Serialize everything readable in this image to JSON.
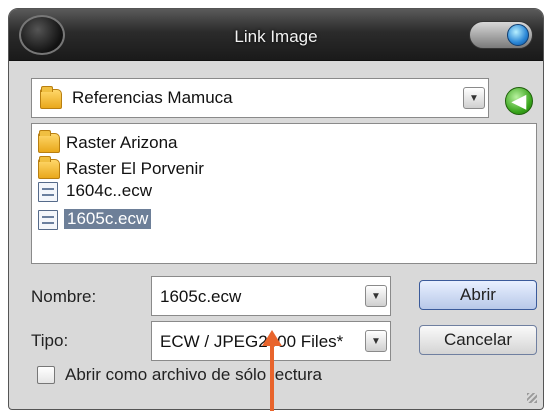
{
  "window": {
    "title": "Link Image"
  },
  "location": {
    "value": "Referencias Mamuca",
    "icon": "folder-icon"
  },
  "navigation": {
    "back_icon": "back-arrow-icon",
    "back_glyph": "◀"
  },
  "files": [
    {
      "name": "Raster Arizona",
      "type": "folder",
      "selected": false
    },
    {
      "name": "Raster El Porvenir",
      "type": "folder",
      "selected": false
    },
    {
      "name": "1604c..ecw",
      "type": "file",
      "selected": false
    },
    {
      "name": "1605c.ecw",
      "type": "file",
      "selected": true
    }
  ],
  "form": {
    "name_label": "Nombre:",
    "name_value": "1605c.ecw",
    "type_label": "Tipo:",
    "type_value": "ECW / JPEG2000 Files*",
    "readonly_label": "Abrir como archivo de sólo lectura",
    "readonly_checked": false
  },
  "buttons": {
    "open": "Abrir",
    "cancel": "Cancelar"
  },
  "colors": {
    "annotation_arrow": "#e8642c",
    "selection": "#6d7f98"
  }
}
